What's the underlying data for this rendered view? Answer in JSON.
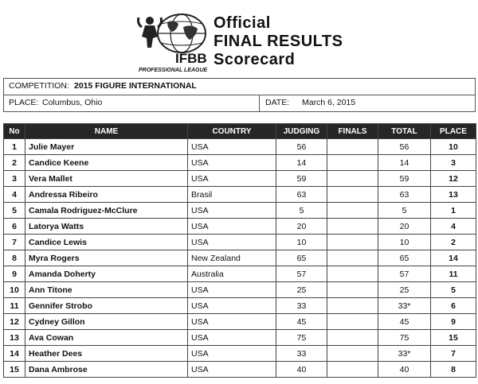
{
  "header": {
    "logo_text": "IFBB",
    "logo_subtext": "PROFESSIONAL LEAGUE",
    "title_line1": "Official",
    "title_line2": "FINAL RESULTS",
    "title_line3": "Scorecard"
  },
  "competition": {
    "label": "COMPETITION:",
    "value": "2015 FIGURE INTERNATIONAL"
  },
  "place": {
    "label": "PLACE:",
    "value": "Columbus, Ohio"
  },
  "date": {
    "label": "DATE:",
    "value": "March 6, 2015"
  },
  "table": {
    "headers": {
      "no": "No",
      "name": "NAME",
      "country": "COUNTRY",
      "judging": "JUDGING",
      "finals": "FINALS",
      "total": "TOTAL",
      "place": "PLACE"
    },
    "rows": [
      {
        "no": "1",
        "name": "Julie Mayer",
        "country": "USA",
        "judging": "56",
        "finals": "",
        "total": "56",
        "place": "10"
      },
      {
        "no": "2",
        "name": "Candice Keene",
        "country": "USA",
        "judging": "14",
        "finals": "",
        "total": "14",
        "place": "3"
      },
      {
        "no": "3",
        "name": "Vera Mallet",
        "country": "USA",
        "judging": "59",
        "finals": "",
        "total": "59",
        "place": "12"
      },
      {
        "no": "4",
        "name": "Andressa Ribeiro",
        "country": "Brasil",
        "judging": "63",
        "finals": "",
        "total": "63",
        "place": "13"
      },
      {
        "no": "5",
        "name": "Camala Rodriguez-McClure",
        "country": "USA",
        "judging": "5",
        "finals": "",
        "total": "5",
        "place": "1"
      },
      {
        "no": "6",
        "name": "Latorya Watts",
        "country": "USA",
        "judging": "20",
        "finals": "",
        "total": "20",
        "place": "4"
      },
      {
        "no": "7",
        "name": "Candice Lewis",
        "country": "USA",
        "judging": "10",
        "finals": "",
        "total": "10",
        "place": "2"
      },
      {
        "no": "8",
        "name": "Myra Rogers",
        "country": "New Zealand",
        "judging": "65",
        "finals": "",
        "total": "65",
        "place": "14"
      },
      {
        "no": "9",
        "name": "Amanda Doherty",
        "country": "Australia",
        "judging": "57",
        "finals": "",
        "total": "57",
        "place": "11"
      },
      {
        "no": "10",
        "name": "Ann Titone",
        "country": "USA",
        "judging": "25",
        "finals": "",
        "total": "25",
        "place": "5"
      },
      {
        "no": "11",
        "name": "Gennifer Strobo",
        "country": "USA",
        "judging": "33",
        "finals": "",
        "total": "33*",
        "place": "6"
      },
      {
        "no": "12",
        "name": "Cydney Gillon",
        "country": "USA",
        "judging": "45",
        "finals": "",
        "total": "45",
        "place": "9"
      },
      {
        "no": "13",
        "name": "Ava Cowan",
        "country": "USA",
        "judging": "75",
        "finals": "",
        "total": "75",
        "place": "15"
      },
      {
        "no": "14",
        "name": "Heather Dees",
        "country": "USA",
        "judging": "33",
        "finals": "",
        "total": "33*",
        "place": "7"
      },
      {
        "no": "15",
        "name": "Dana Ambrose",
        "country": "USA",
        "judging": "40",
        "finals": "",
        "total": "40",
        "place": "8"
      }
    ]
  }
}
